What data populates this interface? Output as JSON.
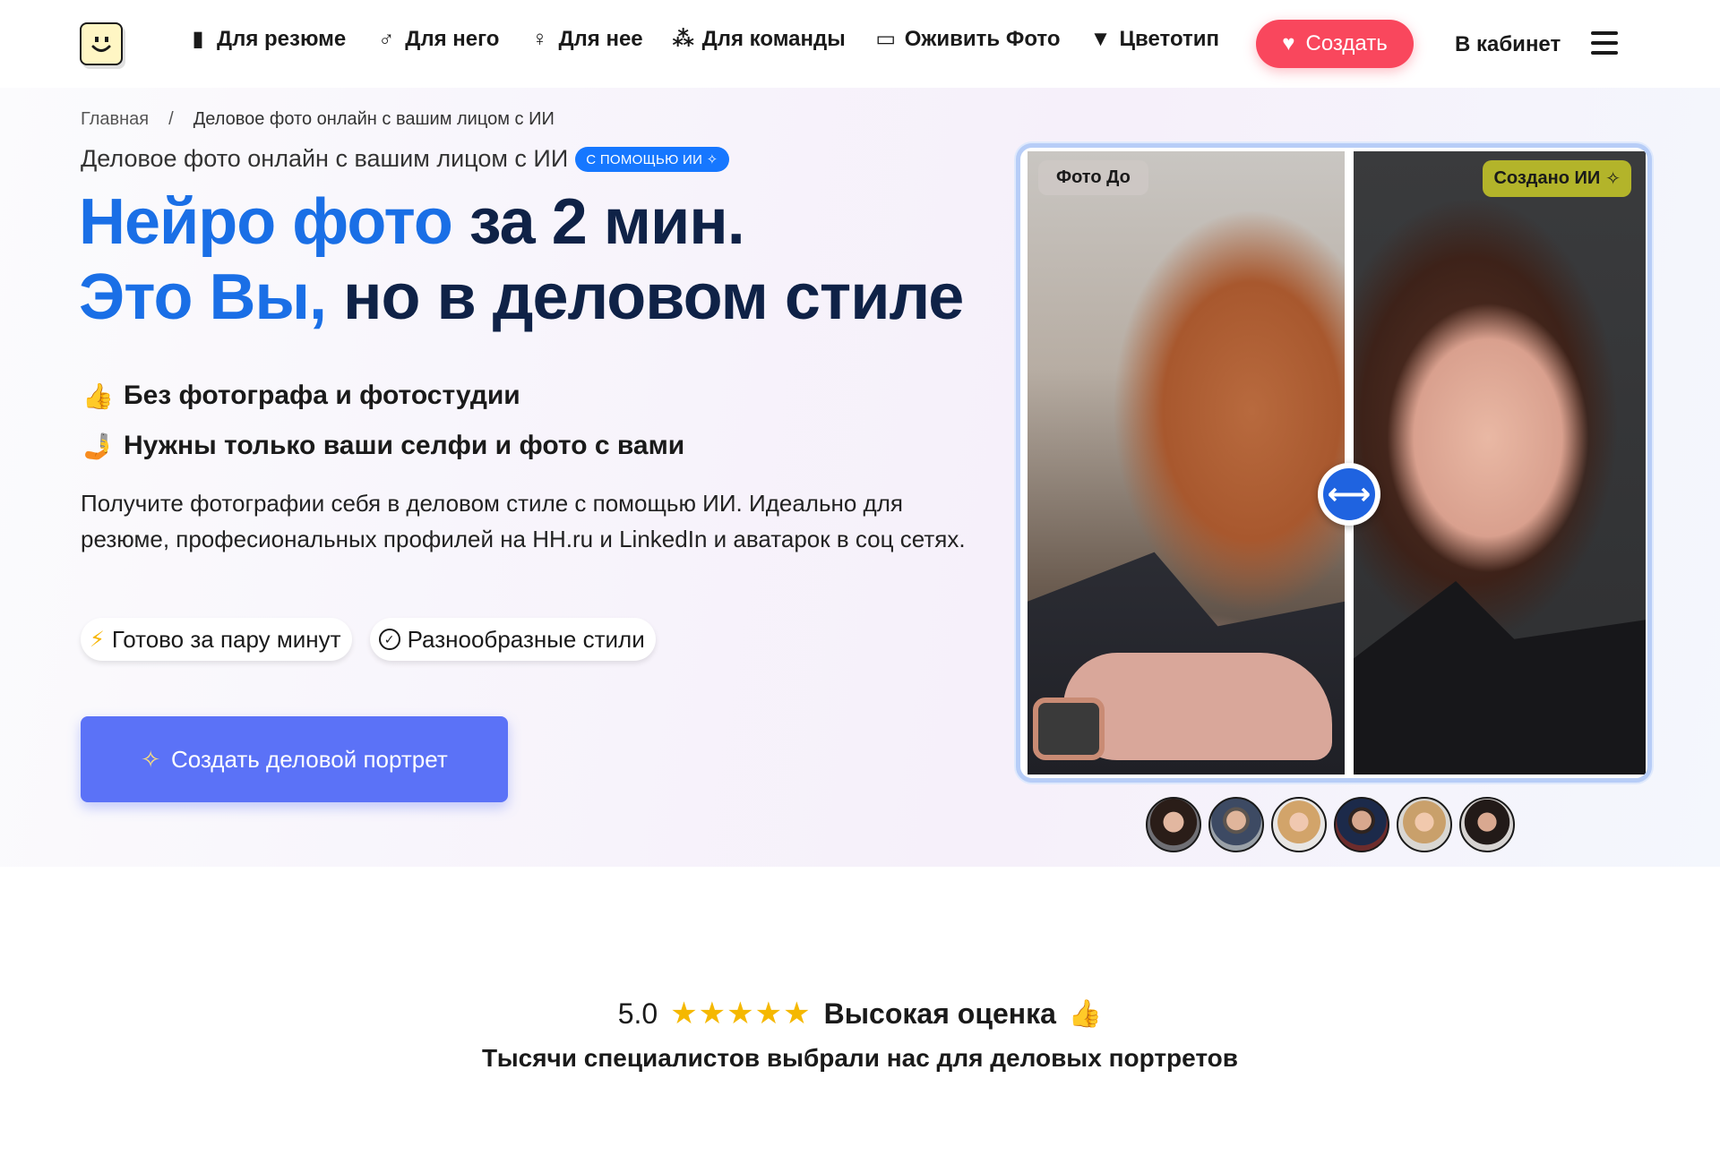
{
  "header": {
    "nav": [
      {
        "label": "Для резюме",
        "icon": "tie-icon",
        "glyph": "👔"
      },
      {
        "label": "Для него",
        "icon": "male-icon",
        "glyph": "♂"
      },
      {
        "label": "Для нее",
        "icon": "female-icon",
        "glyph": "♀"
      },
      {
        "label": "Для команды",
        "icon": "team-icon",
        "glyph": "👥"
      },
      {
        "label": "Оживить Фото",
        "icon": "video-icon",
        "glyph": "📹"
      },
      {
        "label": "Цветотип",
        "icon": "tshirt-icon",
        "glyph": "👕"
      }
    ],
    "create_label": "Создать",
    "create_icon": "heart-icon",
    "cabinet_label": "В кабинет",
    "accent_color": "#f9475d"
  },
  "breadcrumb": {
    "home": "Главная",
    "separator": "/",
    "current": "Деловое фото онлайн с вашим лицом с ИИ"
  },
  "hero": {
    "subtitle": "Деловое фото онлайн с вашим лицом с ИИ",
    "ai_badge": "С ПОМОЩЬЮ ИИ ✧",
    "headline_line1_blue": "Нейро фото",
    "headline_line1_dark": " за 2 мин.",
    "headline_line2_blue": "Это Вы,",
    "headline_line2_dark": " но в деловом стиле",
    "bullets": [
      {
        "icon": "thumbs-up-icon",
        "glyph": "👍",
        "text": "Без фотографа и фотостудии"
      },
      {
        "icon": "selfie-icon",
        "glyph": "🤳",
        "text": "Нужны только ваши селфи и фото с вами"
      }
    ],
    "description": "Получите фотографии себя в деловом стиле с помощью ИИ. Идеально для резюме, професиональных профилей на HH.ru и LinkedIn и аватарок в соц сетях.",
    "chips": [
      {
        "icon": "lightning-icon",
        "text": "Готово за пару минут"
      },
      {
        "icon": "check-circle-icon",
        "text": "Разнообразные стили"
      }
    ],
    "cta_label": "Создать деловой портрет",
    "cta_color": "#5b72f7",
    "headline_blue": "#1a6fe6",
    "headline_dark": "#0f2247"
  },
  "compare": {
    "before_label": "Фото До",
    "after_label": "Создано ИИ",
    "after_icon": "sparkle-icon",
    "handle_icon": "arrows-horizontal-icon",
    "slider_position": 0.5
  },
  "avatars_count": 6,
  "rating": {
    "score": "5.0",
    "stars": "★★★★★",
    "label": "Высокая оценка",
    "emoji": "👍",
    "subtitle": "Тысячи специалистов выбрали нас для деловых портретов"
  }
}
